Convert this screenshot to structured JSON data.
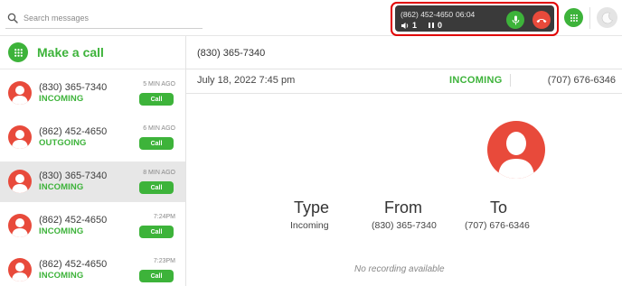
{
  "search": {
    "placeholder": "Search messages"
  },
  "active_call": {
    "number": "(862) 452-4650",
    "timer": "06:04",
    "speaker_count": "1",
    "hold_count": "0"
  },
  "sidebar": {
    "make_call_label": "Make a call",
    "calls": [
      {
        "number": "(830) 365-7340",
        "type": "INCOMING",
        "time": "5 MIN AGO",
        "button": "Call"
      },
      {
        "number": "(862) 452-4650",
        "type": "OUTGOING",
        "time": "6 MIN AGO",
        "button": "Call"
      },
      {
        "number": "(830) 365-7340",
        "type": "INCOMING",
        "time": "8 MIN AGO",
        "button": "Call"
      },
      {
        "number": "(862) 452-4650",
        "type": "INCOMING",
        "time": "7:24PM",
        "button": "Call"
      },
      {
        "number": "(862) 452-4650",
        "type": "INCOMING",
        "time": "7:23PM",
        "button": "Call"
      }
    ]
  },
  "detail": {
    "number": "(830) 365-7340",
    "date": "July 18, 2022 7:45 pm",
    "direction": "INCOMING",
    "to_number": "(707) 676-6346",
    "type_label": "Type",
    "type_value": "Incoming",
    "from_label": "From",
    "from_value": "(830) 365-7340",
    "to_label": "To",
    "to_value": "(707) 676-6346",
    "no_recording": "No recording available"
  },
  "colors": {
    "accent_green": "#3db33a",
    "avatar_red": "#e84a3b",
    "highlight_red": "#e00000",
    "call_bar_bg": "#3a3a3a"
  }
}
